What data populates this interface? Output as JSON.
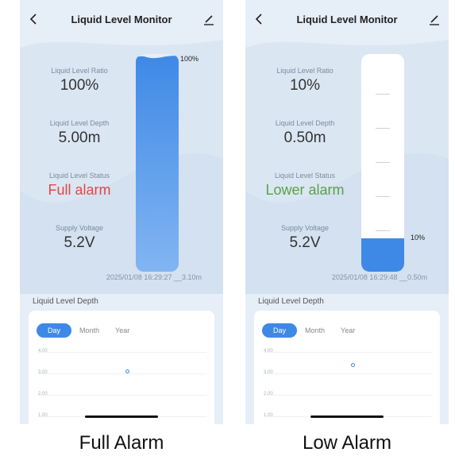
{
  "left": {
    "nav_title": "Liquid Level Monitor",
    "ratio_label": "Liquid Level Ratio",
    "ratio_value": "100%",
    "depth_label": "Liquid Level Depth",
    "depth_value": "5.00m",
    "status_label": "Liquid Level Status",
    "status_value": "Full alarm",
    "voltage_label": "Supply Voltage",
    "voltage_value": "5.2V",
    "tank_percent_label": "100%",
    "tank_fill_fraction": 1.0,
    "timestamp": "2025/01/08 16:29:27 __3.10m",
    "section_title": "Liquid Level Depth",
    "tabs": [
      "Day",
      "Month",
      "Year"
    ],
    "y_labels": [
      "4.00",
      "3.00",
      "2.00",
      "1.00"
    ],
    "chart_point_value": 3.1,
    "caption": "Full Alarm"
  },
  "right": {
    "nav_title": "Liquid Level Monitor",
    "ratio_label": "Liquid Level Ratio",
    "ratio_value": "10%",
    "depth_label": "Liquid Level Depth",
    "depth_value": "0.50m",
    "status_label": "Liquid Level Status",
    "status_value": "Lower alarm",
    "voltage_label": "Supply Voltage",
    "voltage_value": "5.2V",
    "tank_percent_label": "10%",
    "tank_fill_fraction": 0.1,
    "timestamp": "2025/01/08 16:29:48 __0.50m",
    "section_title": "Liquid Level Depth",
    "tabs": [
      "Day",
      "Month",
      "Year"
    ],
    "y_labels": [
      "4.00",
      "3.00",
      "2.00",
      "1.00"
    ],
    "chart_point_value": 3.4,
    "caption": "Low Alarm"
  },
  "colors": {
    "accent": "#3e89e6",
    "full_alarm": "#e04848",
    "low_alarm": "#5aa04a",
    "background": "#e6eef8"
  },
  "icons": {
    "back": "chevron-left-icon",
    "edit": "pencil-icon"
  }
}
